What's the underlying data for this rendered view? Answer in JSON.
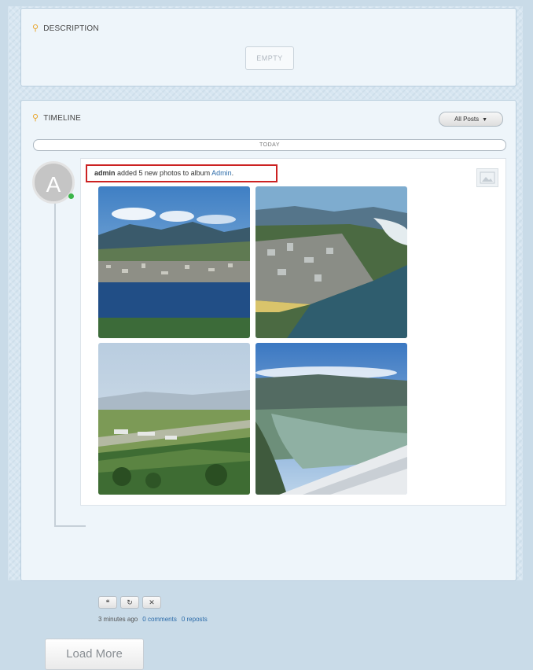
{
  "description": {
    "title": "DESCRIPTION",
    "empty_label": "EMPTY"
  },
  "timeline": {
    "title": "TIMELINE",
    "filter_label": "All Posts",
    "today_label": "TODAY"
  },
  "post": {
    "avatar_letter": "A",
    "author": "admin",
    "action_text": " added 5 new photos to album ",
    "album_link": "Admin",
    "album_suffix": ".",
    "time": "3 minutes ago",
    "comments_link": "0 comments",
    "reposts_link": "0 reposts",
    "actions": [
      "comment-icon",
      "repost-icon",
      "delete-icon"
    ]
  },
  "load_more_label": "Load More",
  "colors": {
    "highlight_border": "#cc2222",
    "link": "#2a6aa8",
    "online": "#3bb54a",
    "section_icon": "#e8a42a"
  }
}
